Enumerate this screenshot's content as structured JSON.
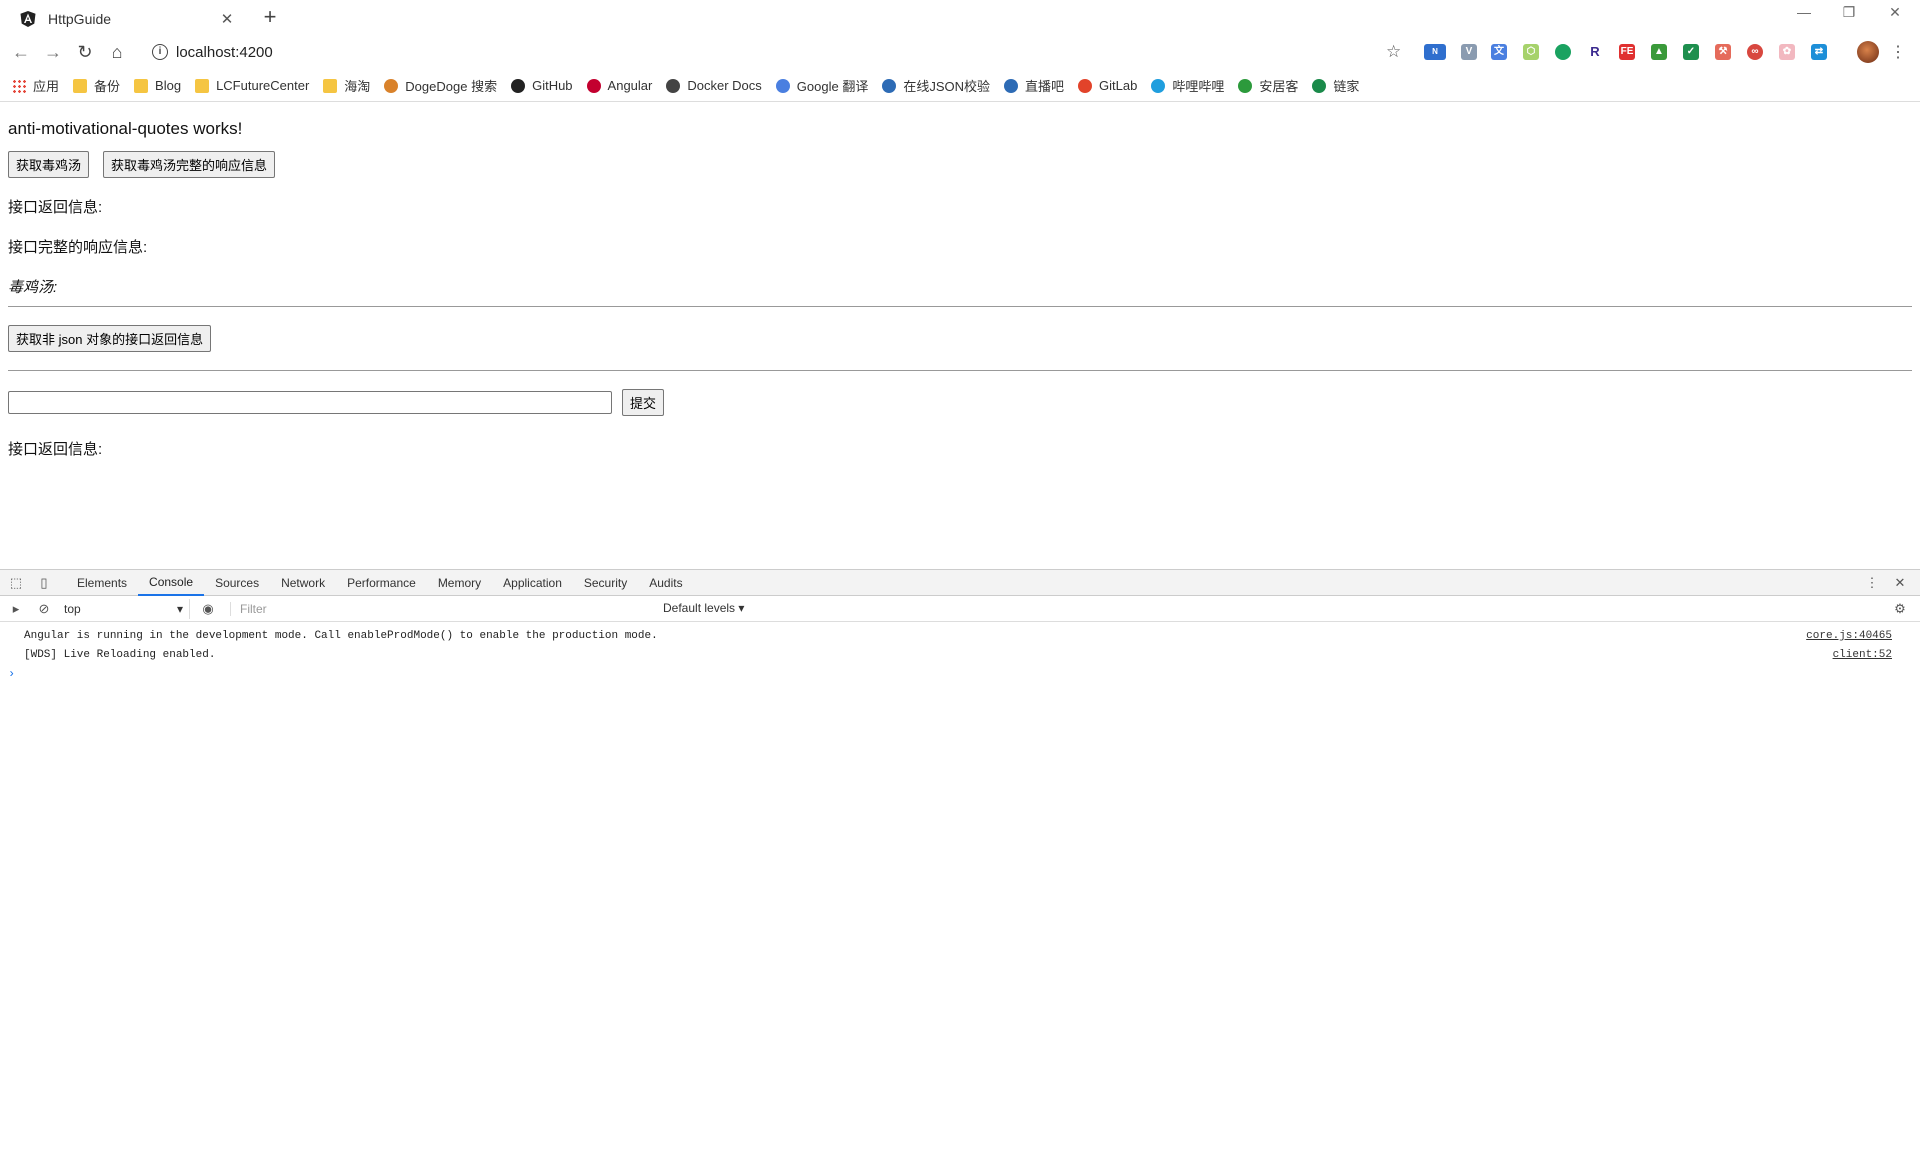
{
  "browser": {
    "tab_title": "HttpGuide",
    "url": "localhost:4200",
    "bookmarks": [
      {
        "label": "应用",
        "icon": "apps-grid-icon"
      },
      {
        "label": "备份",
        "icon": "folder-icon"
      },
      {
        "label": "Blog",
        "icon": "folder-icon"
      },
      {
        "label": "LCFutureCenter",
        "icon": "folder-icon"
      },
      {
        "label": "海淘",
        "icon": "folder-icon"
      },
      {
        "label": "DogeDoge 搜索",
        "icon": "dogedoge-icon"
      },
      {
        "label": "GitHub",
        "icon": "github-icon"
      },
      {
        "label": "Angular",
        "icon": "angular-icon"
      },
      {
        "label": "Docker Docs",
        "icon": "docker-icon"
      },
      {
        "label": "Google 翻译",
        "icon": "google-translate-icon"
      },
      {
        "label": "在线JSON校验",
        "icon": "json-icon"
      },
      {
        "label": "直播吧",
        "icon": "zhibo8-icon"
      },
      {
        "label": "GitLab",
        "icon": "gitlab-icon"
      },
      {
        "label": "哔哩哔哩",
        "icon": "bilibili-icon"
      },
      {
        "label": "安居客",
        "icon": "anjuke-icon"
      },
      {
        "label": "链家",
        "icon": "lianjia-icon"
      }
    ]
  },
  "page": {
    "heading": "anti-motivational-quotes works!",
    "btn_get_quote": "获取毒鸡汤",
    "btn_get_full_response": "获取毒鸡汤完整的响应信息",
    "api_return_label": "接口返回信息:",
    "full_response_label": "接口完整的响应信息:",
    "quote_label": "毒鸡汤:",
    "btn_get_non_json": "获取非 json 对象的接口返回信息",
    "input_value": "",
    "btn_submit": "提交",
    "api_return_label_2": "接口返回信息:"
  },
  "devtools": {
    "tabs": [
      "Elements",
      "Console",
      "Sources",
      "Network",
      "Performance",
      "Memory",
      "Application",
      "Security",
      "Audits"
    ],
    "active_tab": "Console",
    "context": "top",
    "filter_placeholder": "Filter",
    "levels": "Default levels ▾",
    "messages": [
      {
        "text": "Angular is running in the development mode. Call enableProdMode() to enable the production mode.",
        "source": "core.js:40465"
      },
      {
        "text": "[WDS] Live Reloading enabled.",
        "source": "client:52"
      }
    ],
    "prompt": "›"
  }
}
